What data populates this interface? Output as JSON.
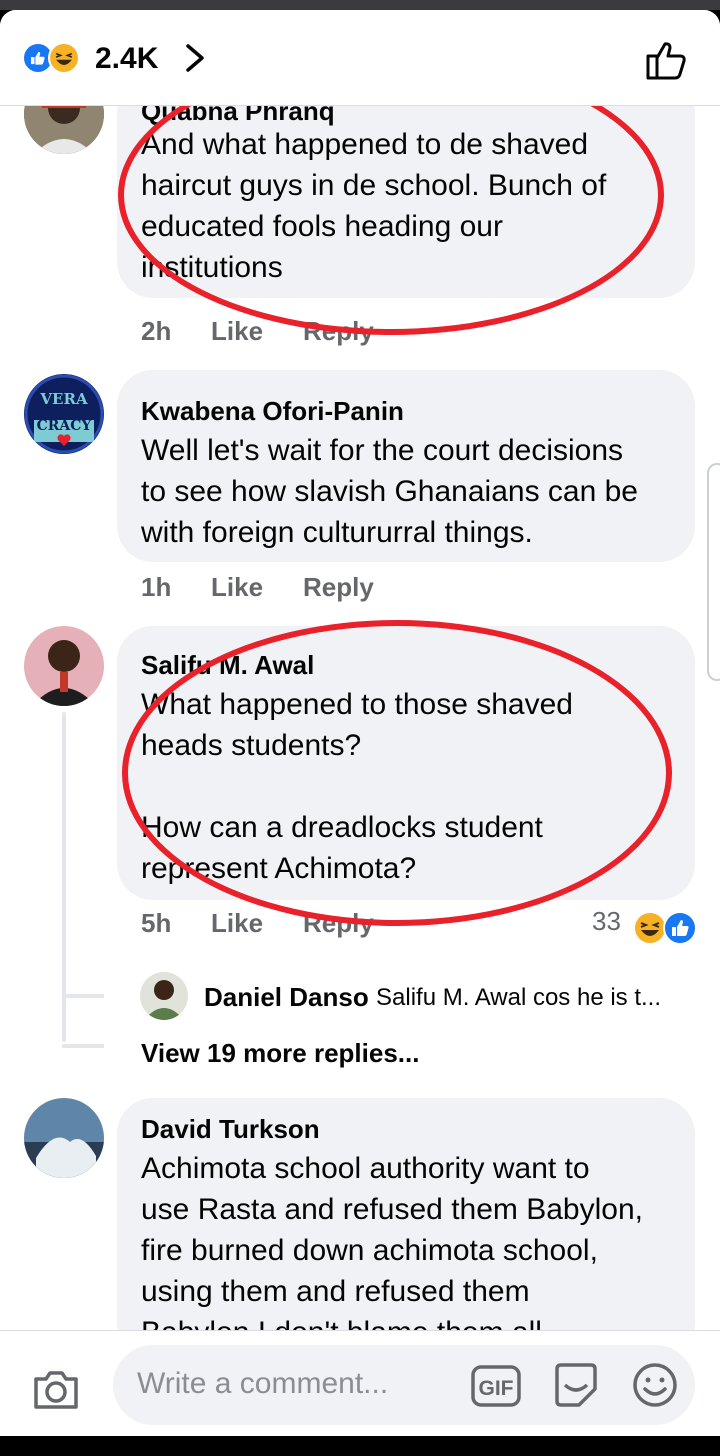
{
  "header": {
    "reaction_count": "2.4K"
  },
  "comments": [
    {
      "name": "Quabna Phranq",
      "text": "And what happened to de shaved\nhaircut guys in de school. Bunch of\neducated fools heading our\ninstitutions",
      "time": "2h",
      "like_label": "Like",
      "reply_label": "Reply"
    },
    {
      "name": "Kwabena Ofori-Panin",
      "avatar_text_1": "VERA",
      "avatar_text_2": "CRACY",
      "text": "Well let's wait for the court decisions\nto see how slavish Ghanaians can be\nwith  foreign cultururral things.",
      "time": "1h",
      "like_label": "Like",
      "reply_label": "Reply"
    },
    {
      "name": "Salifu M. Awal",
      "text": "What happened to those shaved\nheads students?\n\nHow can a dreadlocks student\nrepresent Achimota?",
      "time": "5h",
      "like_label": "Like",
      "reply_label": "Reply",
      "reaction_count": "33",
      "reply_preview": {
        "name": "Daniel Danso",
        "text": "Salifu M. Awal  cos he is t..."
      },
      "view_more": "View 19 more replies..."
    },
    {
      "name": "David Turkson",
      "text": "Achimota school authority want to\nuse Rasta and refused them Babylon,\nfire burned down achimota school,\nusing them and refused them\nBabylon I don't blame them all"
    }
  ],
  "composer": {
    "placeholder": "Write a comment...",
    "gif_label": "GIF"
  },
  "colors": {
    "facebook_blue": "#1877f2",
    "annotation_red": "#e8212a",
    "bubble_gray": "#f0f2f5",
    "meta_gray": "#65676b"
  },
  "icons": [
    "like-reaction-icon",
    "haha-reaction-icon",
    "chevron-right-icon",
    "thumbs-up-icon",
    "camera-icon",
    "gif-icon",
    "sticker-icon",
    "emoji-icon"
  ]
}
